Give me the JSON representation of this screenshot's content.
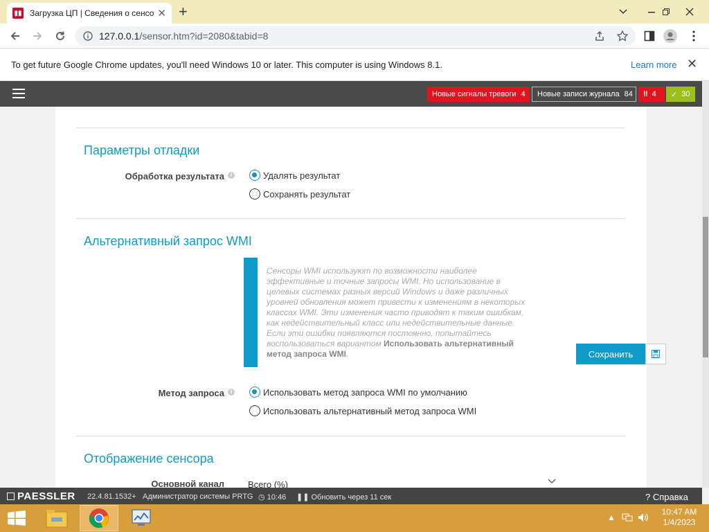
{
  "browser": {
    "tab_title": "Загрузка ЦП | Сведения о сенсо",
    "tab_favicon": "prtg-favicon",
    "url_host": "127.0.0.1",
    "url_path": "/sensor.htm?id=2080&tabid=8"
  },
  "infobar": {
    "message": "To get future Google Chrome updates, you'll need Windows 10 or later. This computer is using Windows 8.1.",
    "learn_more": "Learn more"
  },
  "prtg_header": {
    "alarms_label": "Новые сигналы тревоги",
    "alarms_count": "4",
    "log_label": "Новые записи журнала",
    "log_count": "84",
    "error_count": "4",
    "ok_count": "30",
    "colors": {
      "alarm": "#e0141e",
      "ok": "#9bc01b",
      "dark": "#4a4a4a"
    }
  },
  "debug_section": {
    "title": "Параметры отладки",
    "field_label": "Обработка результата",
    "options": [
      "Удалять результат",
      "Сохранять результат"
    ],
    "selected": 0
  },
  "wmi_section": {
    "title": "Альтернативный запрос WMI",
    "note_text": "Сенсоры WMI используют по возможности наиболее эффективные и точные запросы WMI. Но использование в целевых системах разных версий Windows и даже различных уровней обновления может привести к изменениям в некоторых классах WMI. Эти изменения часто приводят к таким ошибкам, как недействительный класс или недействительные данные. Если эти ошибки появляются постоянно, попытайтесь воспользоваться вариантом",
    "note_bold": "Использовать альтернативный метод запроса WMI",
    "field_label": "Метод запроса",
    "options": [
      "Использовать метод запроса WMI по умолчанию",
      "Использовать альтернативный метод запроса WMI"
    ],
    "selected": 0
  },
  "display_section": {
    "title": "Отображение сенсора",
    "field_label": "Основной канал",
    "selected_value": "Всего (%)"
  },
  "save_button": "Сохранить",
  "footer": {
    "logo": "PAESSLER",
    "version": "22.4.81.1532+",
    "user": "Администратор системы PRTG",
    "time": "10:46",
    "refresh": "Обновить через 11 сек",
    "help": "Справка"
  },
  "taskbar": {
    "time": "10:47 AM",
    "date": "1/4/2023"
  }
}
